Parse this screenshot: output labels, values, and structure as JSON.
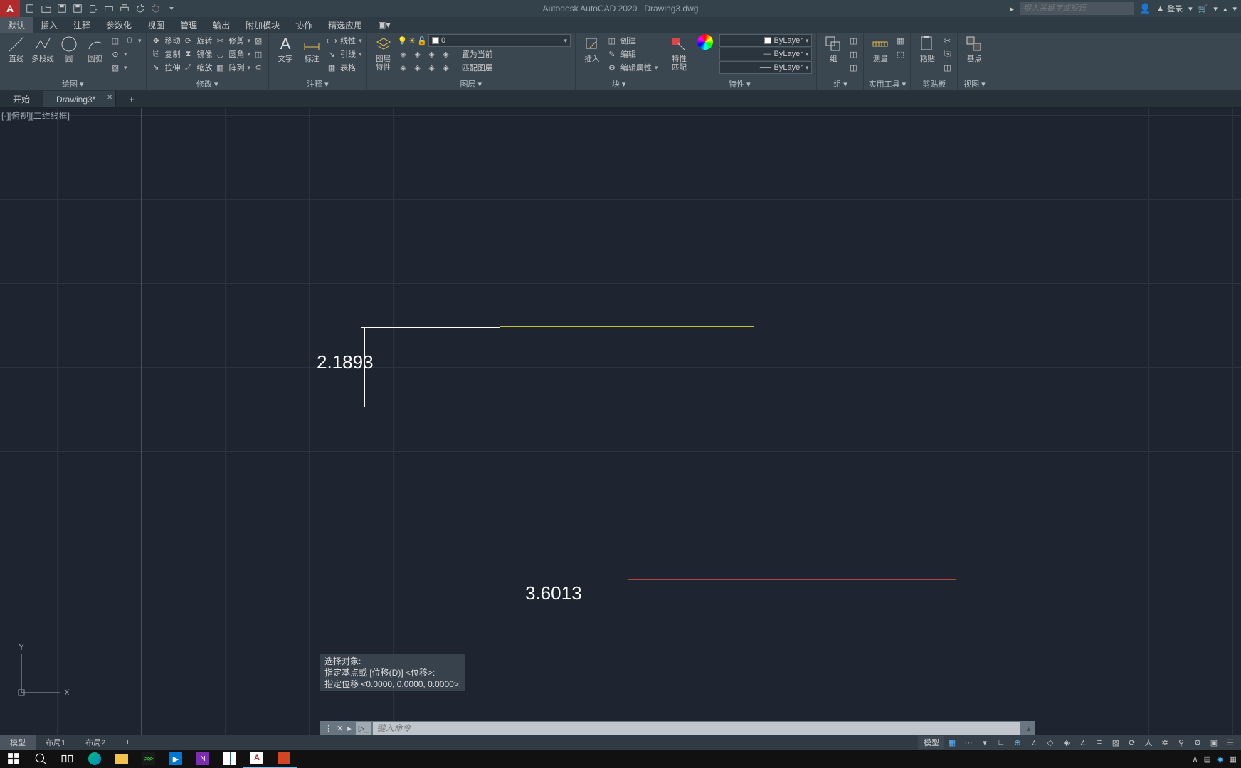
{
  "title": {
    "app": "Autodesk AutoCAD 2020",
    "file": "Drawing3.dwg"
  },
  "search_placeholder": "键入关键字或短语",
  "login": "登录",
  "menu": [
    "默认",
    "插入",
    "注释",
    "参数化",
    "视图",
    "管理",
    "输出",
    "附加模块",
    "协作",
    "精选应用"
  ],
  "active_menu": 0,
  "ribbon": {
    "panel_draw": {
      "label": "绘图",
      "items": [
        "直线",
        "多段线",
        "圆",
        "圆弧"
      ]
    },
    "panel_modify": {
      "label": "修改",
      "rows": [
        [
          "移动",
          "旋转",
          "修剪"
        ],
        [
          "复制",
          "镜像",
          "圆角"
        ],
        [
          "拉伸",
          "缩放",
          "阵列"
        ]
      ]
    },
    "panel_annot": {
      "label": "注释",
      "big": [
        "文字",
        "标注"
      ],
      "rows": [
        "线性",
        "引线",
        "表格"
      ]
    },
    "panel_layers": {
      "label": "图层",
      "big": "图层\n特性",
      "current": "0",
      "rows": [
        "置为当前",
        "匹配图层"
      ]
    },
    "panel_block": {
      "label": "块",
      "big": "插入",
      "rows": [
        "创建",
        "编辑",
        "编辑属性"
      ]
    },
    "panel_props": {
      "label": "特性",
      "big": "特性\n匹配",
      "vals": [
        "ByLayer",
        "ByLayer",
        "ByLayer"
      ]
    },
    "panel_group": {
      "label": "组",
      "big": "组"
    },
    "panel_util": {
      "label": "实用工具",
      "big": "测量"
    },
    "panel_clip": {
      "label": "剪贴板",
      "big": "粘贴"
    },
    "panel_view": {
      "label": "视图",
      "big": "基点"
    }
  },
  "doc_tabs": {
    "start": "开始",
    "active": "Drawing3*",
    "add": "+"
  },
  "viewport_label": "[-][俯视][二维线框]",
  "dimensions": {
    "v": "2.1893",
    "h": "3.6013"
  },
  "ucs": {
    "x": "X",
    "y": "Y"
  },
  "cmd_history": [
    "选择对象:",
    "指定基点或 [位移(D)] <位移>:",
    "指定位移 <0.0000, 0.0000, 0.0000>:"
  ],
  "cmd_placeholder": "键入命令",
  "layout_tabs": [
    "模型",
    "布局1",
    "布局2"
  ],
  "status_model": "模型",
  "taskbar_tray": [
    "∧",
    "▤"
  ]
}
